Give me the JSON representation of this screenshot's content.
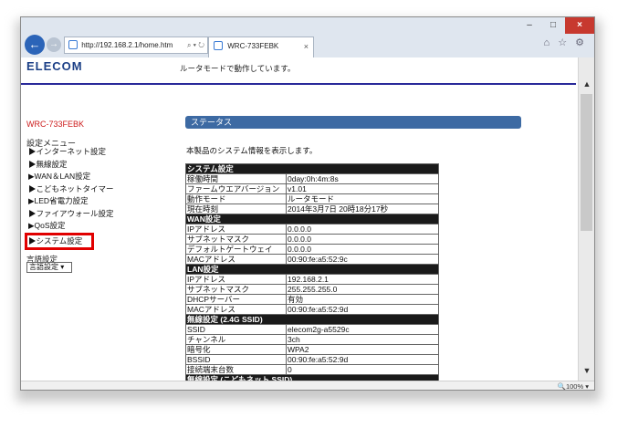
{
  "browser": {
    "address": "http://192.168.2.1/home.htm",
    "address_controls": "⌕ ▾ ↻",
    "tab_title": "WRC-733FEBK",
    "tab_close": "×",
    "window_min": "–",
    "window_max": "□",
    "window_close": "×",
    "back": "←",
    "forward": "→",
    "tools": "⌂ ☆ ⚙",
    "zoom": "🔍100%  ▾"
  },
  "header": {
    "logo": "ELECOM",
    "mode_message": "ルータモードで動作しています。"
  },
  "sidebar": {
    "model": "WRC-733FEBK",
    "menu_title": "設定メニュー",
    "items": [
      "▶インターネット設定",
      "▶無線設定",
      "▶WAN＆LAN設定",
      "▶こどもネットタイマー",
      "▶LED省電力設定",
      "▶ファイアウォール設定",
      "▶QoS設定",
      "▶システム設定"
    ],
    "language_label": "言語設定",
    "language_value": "言語設定 ▾"
  },
  "main": {
    "section_title": "ステータス",
    "intro": "本製品のシステム情報を表示します。",
    "table": [
      {
        "section": "システム設定"
      },
      {
        "k": "稼働時間",
        "v": "0day:0h:4m:8s"
      },
      {
        "k": "ファームウエアバージョン",
        "v": "v1.01"
      },
      {
        "k": "動作モード",
        "v": "ルータモード"
      },
      {
        "k": "現在時刻",
        "v": "2014年3月7日 20時18分17秒"
      },
      {
        "section": "WAN設定"
      },
      {
        "k": "IPアドレス",
        "v": "0.0.0.0"
      },
      {
        "k": "サブネットマスク",
        "v": "0.0.0.0"
      },
      {
        "k": "デフォルトゲートウェイ",
        "v": "0.0.0.0"
      },
      {
        "k": "MACアドレス",
        "v": "00:90:fe:a5:52:9c"
      },
      {
        "section": "LAN設定"
      },
      {
        "k": "IPアドレス",
        "v": "192.168.2.1"
      },
      {
        "k": "サブネットマスク",
        "v": "255.255.255.0"
      },
      {
        "k": "DHCPサーバー",
        "v": "有効"
      },
      {
        "k": "MACアドレス",
        "v": "00:90:fe:a5:52:9d"
      },
      {
        "section": "無線設定 (2.4G SSID)"
      },
      {
        "k": "SSID",
        "v": "elecom2g-a5529c"
      },
      {
        "k": "チャンネル",
        "v": "3ch"
      },
      {
        "k": "暗号化",
        "v": "WPA2"
      },
      {
        "k": "BSSID",
        "v": "00:90:fe:a5:52:9d"
      },
      {
        "k": "接続端末台数",
        "v": "0"
      },
      {
        "section": "無線設定 (こどもネット SSID)"
      }
    ]
  }
}
